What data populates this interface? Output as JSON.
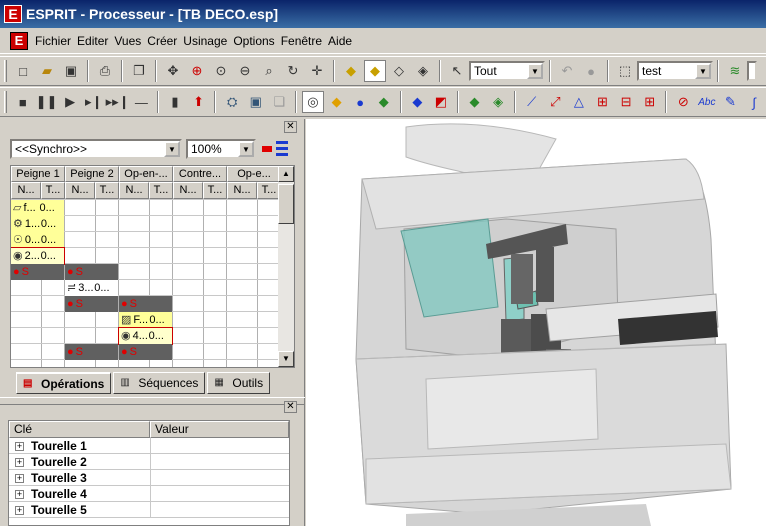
{
  "titlebar": {
    "icon_letter": "E",
    "title": "ESPRIT - Processeur - [TB DECO.esp]"
  },
  "menubar": {
    "icon_letter": "E",
    "items": [
      "Fichier",
      "Editer",
      "Vues",
      "Créer",
      "Usinage",
      "Options",
      "Fenêtre",
      "Aide"
    ]
  },
  "toolbar1": {
    "select_value": "Tout",
    "view_value": "test"
  },
  "operations_panel": {
    "synchro_value": "<<Synchro>>",
    "zoom_value": "100%",
    "columns": [
      {
        "title": "Peigne 1",
        "sub": [
          "N...",
          "T..."
        ]
      },
      {
        "title": "Peigne 2",
        "sub": [
          "N...",
          "T..."
        ]
      },
      {
        "title": "Op-en-...",
        "sub": [
          "N...",
          "T..."
        ]
      },
      {
        "title": "Contre...",
        "sub": [
          "N...",
          "T..."
        ]
      },
      {
        "title": "Op-e...",
        "sub": [
          "N...",
          "T..."
        ]
      }
    ],
    "cells": [
      {
        "col": 0,
        "row": 0,
        "n": "f...",
        "t": "0...",
        "style": "yellow",
        "icon": "face-icon"
      },
      {
        "col": 0,
        "row": 1,
        "n": "1...",
        "t": "0...",
        "style": "yellow",
        "icon": "drill-icon"
      },
      {
        "col": 0,
        "row": 2,
        "n": "0...",
        "t": "0...",
        "style": "yellow",
        "icon": "tool-icon"
      },
      {
        "col": 0,
        "row": 3,
        "n": "2...",
        "t": "0...",
        "style": "selected",
        "icon": "contour-icon"
      },
      {
        "col": 0,
        "row": 4,
        "n": "S",
        "t": "",
        "style": "sync",
        "icon": "sync-dot-icon"
      },
      {
        "col": 1,
        "row": 4,
        "n": "S",
        "t": "",
        "style": "sync",
        "icon": "sync-dot-icon"
      },
      {
        "col": 1,
        "row": 5,
        "n": "3...",
        "t": "0...",
        "style": "white",
        "icon": "thread-icon"
      },
      {
        "col": 1,
        "row": 6,
        "n": "S",
        "t": "",
        "style": "sync",
        "icon": "sync-dot-icon"
      },
      {
        "col": 2,
        "row": 6,
        "n": "S",
        "t": "",
        "style": "sync",
        "icon": "sync-dot-icon"
      },
      {
        "col": 2,
        "row": 7,
        "n": "F...",
        "t": "0...",
        "style": "yellow",
        "icon": "cutoff-icon"
      },
      {
        "col": 2,
        "row": 8,
        "n": "4...",
        "t": "0...",
        "style": "selected",
        "icon": "contour-icon"
      },
      {
        "col": 1,
        "row": 9,
        "n": "S",
        "t": "",
        "style": "sync",
        "icon": "sync-dot-icon"
      },
      {
        "col": 2,
        "row": 9,
        "n": "S",
        "t": "",
        "style": "sync",
        "icon": "sync-dot-icon"
      }
    ],
    "tabs": [
      "Opérations",
      "Séquences",
      "Outils"
    ]
  },
  "properties_panel": {
    "headers": [
      "Clé",
      "Valeur"
    ],
    "rows": [
      "Tourelle 1",
      "Tourelle 2",
      "Tourelle 3",
      "Tourelle 4",
      "Tourelle 5"
    ]
  },
  "colors": {
    "title_start": "#0a246a",
    "title_end": "#3a6ea5",
    "cell_yellow": "#ffff99",
    "cell_sync": "#606060",
    "sync_dot": "#e00000",
    "selected_cell": "#ffffcc",
    "glass": "#7fc8c0"
  }
}
